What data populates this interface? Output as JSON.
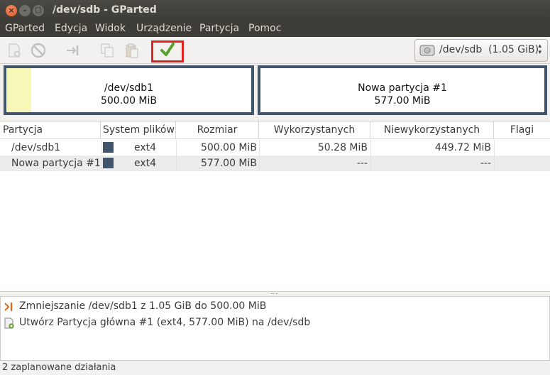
{
  "window": {
    "title": "/dev/sdb - GParted",
    "close_glyph": "×",
    "min_glyph": "–",
    "max_glyph": "□"
  },
  "menu": {
    "items": [
      "GParted",
      "Edycja",
      "Widok",
      "Urządzenie",
      "Partycja",
      "Pomoc"
    ]
  },
  "toolbar": {
    "buttons": [
      {
        "icon": "new-partition-icon",
        "enabled": false
      },
      {
        "icon": "delete-icon",
        "enabled": false
      },
      {
        "icon": "resize-move-icon",
        "enabled": false
      },
      {
        "icon": "copy-icon",
        "enabled": false
      },
      {
        "icon": "paste-icon",
        "enabled": false
      },
      {
        "icon": "apply-check-icon",
        "enabled": true,
        "highlighted": true
      }
    ],
    "device_selector": {
      "label": "/dev/sdb  (1.05 GiB)",
      "icon": "harddisk-icon"
    }
  },
  "partition_map": [
    {
      "name": "/dev/sdb1",
      "size": "500.00 MiB",
      "used_fraction": 0.1
    },
    {
      "name": "Nowa partycja #1",
      "size": "577.00 MiB",
      "used_fraction": 0
    }
  ],
  "table": {
    "columns": [
      "Partycja",
      "System plików",
      "Rozmiar",
      "Wykorzystanych",
      "Niewykorzystanych",
      "Flagi"
    ],
    "rows": [
      {
        "partition": "/dev/sdb1",
        "filesystem": "ext4",
        "fs_color": "#42566b",
        "size": "500.00 MiB",
        "used": "50.28 MiB",
        "unused": "449.72 MiB",
        "flags": ""
      },
      {
        "partition": "Nowa partycja #1",
        "filesystem": "ext4",
        "fs_color": "#42566b",
        "size": "577.00 MiB",
        "used": "---",
        "unused": "---",
        "flags": ""
      }
    ]
  },
  "operations": [
    {
      "icon": "resize-operation-icon",
      "text": "Zmniejszanie /dev/sdb1 z 1.05 GiB do 500.00 MiB"
    },
    {
      "icon": "create-operation-icon",
      "text": "Utwórz Partycja główna #1 (ext4, 577.00 MiB) na /dev/sdb"
    }
  ],
  "status": {
    "text": "2 zaplanowane działania"
  },
  "colors": {
    "partition_border": "#42566b",
    "used_space": "#f7f7b8",
    "highlight": "#e0221c",
    "apply_green": "#5aa02c"
  }
}
